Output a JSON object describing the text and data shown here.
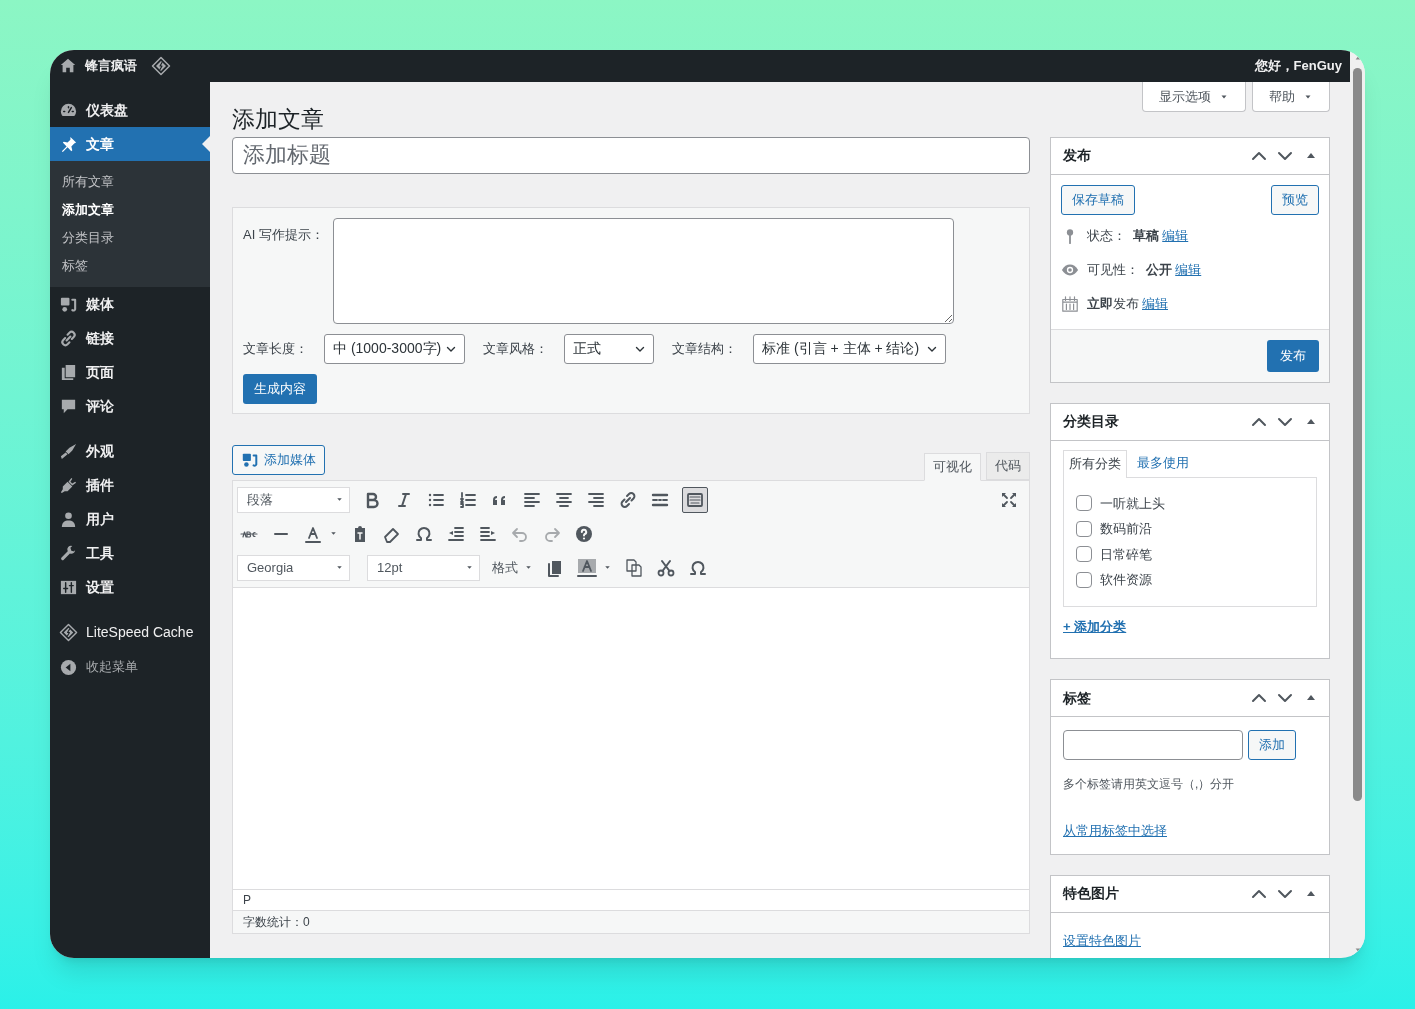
{
  "admin_bar": {
    "site_name": "锋言疯语",
    "greeting": "您好，FenGuy"
  },
  "sidebar": {
    "groups": [
      {
        "items": [
          {
            "kind": "dashboard",
            "label": "仪表盘",
            "selected": false
          },
          {
            "kind": "posts",
            "label": "文章",
            "selected": true,
            "children": [
              {
                "label": "所有文章",
                "selected": false
              },
              {
                "label": "添加文章",
                "selected": true
              },
              {
                "label": "分类目录",
                "selected": false
              },
              {
                "label": "标签",
                "selected": false
              }
            ]
          },
          {
            "kind": "media",
            "label": "媒体",
            "selected": false
          },
          {
            "kind": "links",
            "label": "链接",
            "selected": false
          },
          {
            "kind": "pages",
            "label": "页面",
            "selected": false
          },
          {
            "kind": "comments",
            "label": "评论",
            "selected": false
          }
        ]
      },
      {
        "items": [
          {
            "kind": "appearance",
            "label": "外观",
            "selected": false
          },
          {
            "kind": "plugins",
            "label": "插件",
            "selected": false
          },
          {
            "kind": "users",
            "label": "用户",
            "selected": false
          },
          {
            "kind": "tools",
            "label": "工具",
            "selected": false
          },
          {
            "kind": "settings",
            "label": "设置",
            "selected": false
          }
        ]
      },
      {
        "items": [
          {
            "kind": "litespeed",
            "label": "LiteSpeed Cache",
            "selected": false
          }
        ]
      }
    ],
    "collapse": "收起菜单"
  },
  "screen_tabs": [
    "显示选项",
    "帮助"
  ],
  "page_title": "添加文章",
  "title_field": {
    "placeholder": "添加标题"
  },
  "ai_panel": {
    "prompt_label": "AI 写作提示：",
    "options": [
      {
        "label": "文章长度：",
        "value": "中 (1000-3000字)"
      },
      {
        "label": "文章风格：",
        "value": "正式"
      },
      {
        "label": "文章结构：",
        "value": "标准 (引言 + 主体 + 结论)"
      }
    ],
    "generate_button": "生成内容"
  },
  "editor": {
    "add_media": "添加媒体",
    "tabs": [
      {
        "label": "可视化",
        "selected": true
      },
      {
        "label": "代码",
        "selected": false
      }
    ],
    "format_select": "段落",
    "font_select": "Georgia",
    "size_select": "12pt",
    "format_menu": "格式",
    "toolbar_toggle_on": true,
    "undo_disabled": true,
    "redo_disabled": true,
    "path": "P",
    "word_count": "字数统计：0"
  },
  "publish_box": {
    "title": "发布",
    "save_draft": "保存草稿",
    "preview": "预览",
    "rows": [
      {
        "kind": "status",
        "text": "状态：  **草稿**",
        "link": "编辑"
      },
      {
        "kind": "visibility",
        "text": "可见性：  **公开**",
        "link": "编辑"
      },
      {
        "kind": "schedule",
        "text": "**立即**发布",
        "link": "编辑"
      }
    ],
    "publish_button": "发布"
  },
  "categories_box": {
    "title": "分类目录",
    "tabs": [
      {
        "label": "所有分类",
        "selected": true
      },
      {
        "label": "最多使用",
        "selected": false
      }
    ],
    "items": [
      {
        "label": "一听就上头",
        "checked": false
      },
      {
        "label": "数码前沿",
        "checked": false
      },
      {
        "label": "日常碎笔",
        "checked": false
      },
      {
        "label": "软件资源",
        "checked": false
      }
    ],
    "add_link": "+ 添加分类"
  },
  "tags_box": {
    "title": "标签",
    "add_button": "添加",
    "hint": "多个标签请用英文逗号（,）分开",
    "choose_link": "从常用标签中选择"
  },
  "featured_box": {
    "title": "特色图片",
    "link": "设置特色图片"
  }
}
